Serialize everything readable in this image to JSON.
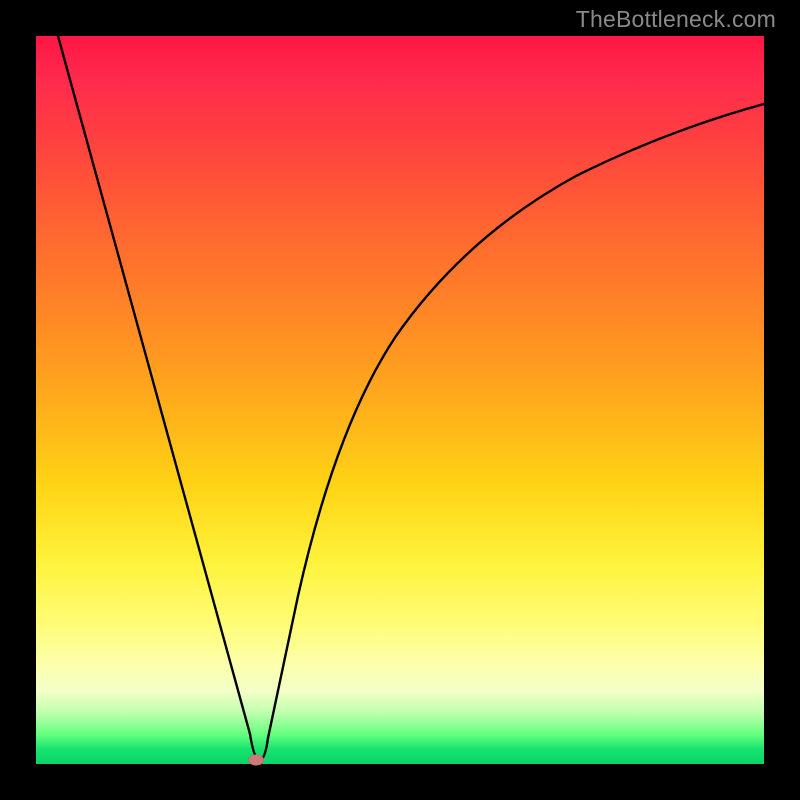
{
  "watermark": "TheBottleneck.com",
  "chart_data": {
    "type": "line",
    "title": "",
    "xlabel": "",
    "ylabel": "",
    "xrange": [
      0,
      1
    ],
    "yrange": [
      0,
      1
    ],
    "series": [
      {
        "name": "curve",
        "x": [
          0.03,
          0.08,
          0.14,
          0.2,
          0.26,
          0.295,
          0.305,
          0.32,
          0.36,
          0.4,
          0.46,
          0.54,
          0.62,
          0.72,
          0.84,
          1.0
        ],
        "y": [
          1.0,
          0.83,
          0.62,
          0.42,
          0.2,
          0.04,
          0.04,
          0.12,
          0.3,
          0.45,
          0.58,
          0.7,
          0.77,
          0.83,
          0.875,
          0.91
        ]
      }
    ],
    "marker": {
      "x": 0.3,
      "y": 0.005
    },
    "gradient_stops": [
      {
        "pos": 0.0,
        "color": "#ff1744"
      },
      {
        "pos": 0.5,
        "color": "#ffc21a"
      },
      {
        "pos": 0.8,
        "color": "#fffc70"
      },
      {
        "pos": 1.0,
        "color": "#09d466"
      }
    ]
  }
}
